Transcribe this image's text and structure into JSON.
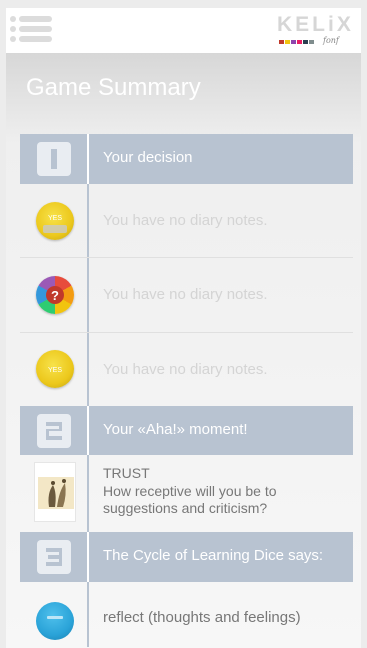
{
  "header": {
    "logo_text": "KELiX",
    "logo_script": "fonf",
    "logo_squares": [
      "#c0392b",
      "#f1c40f",
      "#8e44ad",
      "#e91e63",
      "#2c3e50",
      "#7f8c8d"
    ]
  },
  "page": {
    "title": "Game Summary"
  },
  "sections": [
    {
      "number": "1",
      "title": "Your decision",
      "rows": [
        {
          "icon": "yes-die-icon",
          "note": "You have no diary notes."
        },
        {
          "icon": "question-die-icon",
          "note": "You have no diary notes."
        },
        {
          "icon": "yes-die-icon",
          "note": "You have no diary notes."
        }
      ]
    },
    {
      "number": "2",
      "title": "Your «Aha!» moment!",
      "card": {
        "icon": "trust-card-icon",
        "title": "TRUST",
        "question": "How receptive will you be to suggestions and criticism?"
      }
    },
    {
      "number": "3",
      "title": "The Cycle of Learning Dice says:",
      "result": {
        "icon": "reflect-die-icon",
        "text": "reflect (thoughts and feelings)"
      }
    }
  ],
  "colors": {
    "section_header": "#b8c3d1",
    "accent_yellow": "#f1d02a",
    "accent_blue": "#2aa3d8"
  }
}
